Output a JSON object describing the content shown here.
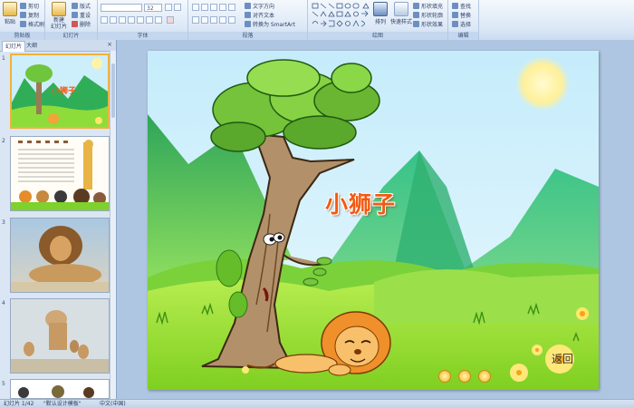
{
  "ribbon": {
    "clipboard": {
      "paste": "粘贴",
      "cut": "剪切",
      "copy": "复制",
      "format_painter": "格式刷",
      "label": "剪贴板"
    },
    "slides": {
      "new_slide": "新建\n幻灯片",
      "layout": "版式",
      "reset": "重设",
      "delete": "删除",
      "label": "幻灯片"
    },
    "font": {
      "font_size": "32",
      "label": "字体"
    },
    "paragraph": {
      "text_direction": "文字方向",
      "align_text": "对齐文本",
      "smartart": "转换为 SmartArt",
      "label": "段落"
    },
    "drawing": {
      "arrange": "排列",
      "quick_styles": "快速样式",
      "shape_fill": "形状填充",
      "shape_outline": "形状轮廓",
      "shape_effects": "形状效果",
      "label": "绘图"
    },
    "editing": {
      "find": "查找",
      "replace": "替换",
      "select": "选择",
      "label": "编辑"
    }
  },
  "panel": {
    "tabs": [
      "幻灯片",
      "大纲"
    ],
    "close": "×",
    "thumbnails": [
      {
        "num": "1",
        "selected": true,
        "caption": "小狮子"
      },
      {
        "num": "2",
        "selected": false
      },
      {
        "num": "3",
        "selected": false
      },
      {
        "num": "4",
        "selected": false
      },
      {
        "num": "5",
        "selected": false
      }
    ]
  },
  "slide": {
    "title": "小狮子",
    "back_button": "返回",
    "controls": [
      "play",
      "pause",
      "stop"
    ]
  },
  "status": {
    "slide_position": "幻灯片 1/42",
    "theme": "\"默认设计模板\"",
    "language": "中文(中国)"
  },
  "colors": {
    "sky": "#cdeefb",
    "grass": "#7fd12c",
    "mountain": "#2fae57",
    "title": "#f25a12"
  }
}
